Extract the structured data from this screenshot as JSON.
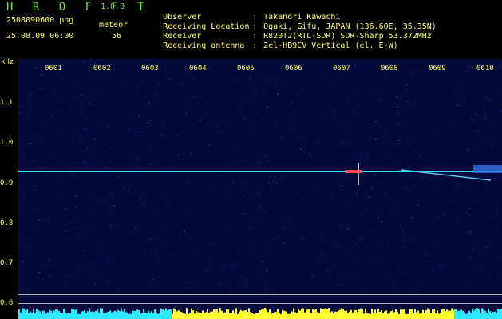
{
  "header": {
    "app_name": "H R O F F T",
    "app_version": "1.0.0",
    "file_name": "2508090600.png",
    "date_time": "25.08.09 06:00",
    "meteor_label": "meteor",
    "meteor_count": "56",
    "info": [
      {
        "key": "Observer",
        "value": "Takanori Kawachi"
      },
      {
        "key": "Receiving Location",
        "value": "Ogaki, Gifu, JAPAN (136.60E, 35.35N)"
      },
      {
        "key": "Receiver",
        "value": "R820T2(RTL-SDR) SDR-Sharp 53.372MHz"
      },
      {
        "key": "Receiving antenna",
        "value": "2el-HB9CV Vertical (el. E-W)"
      }
    ]
  },
  "axes": {
    "unit": "kHz",
    "y_ticks": [
      "1.1",
      "1.0",
      "0.9",
      "0.8",
      "0.7",
      "0.6"
    ],
    "x_ticks": [
      "0601",
      "0602",
      "0603",
      "0604",
      "0605",
      "0606",
      "0607",
      "0608",
      "0609",
      "0610"
    ]
  },
  "colors": {
    "background": "#000000",
    "label": "#ffff66",
    "title": "#7be34f",
    "signal": "#2ee8e8",
    "power_bar_low": "#2ee8ff",
    "power_bar_high": "#ffff33"
  }
}
